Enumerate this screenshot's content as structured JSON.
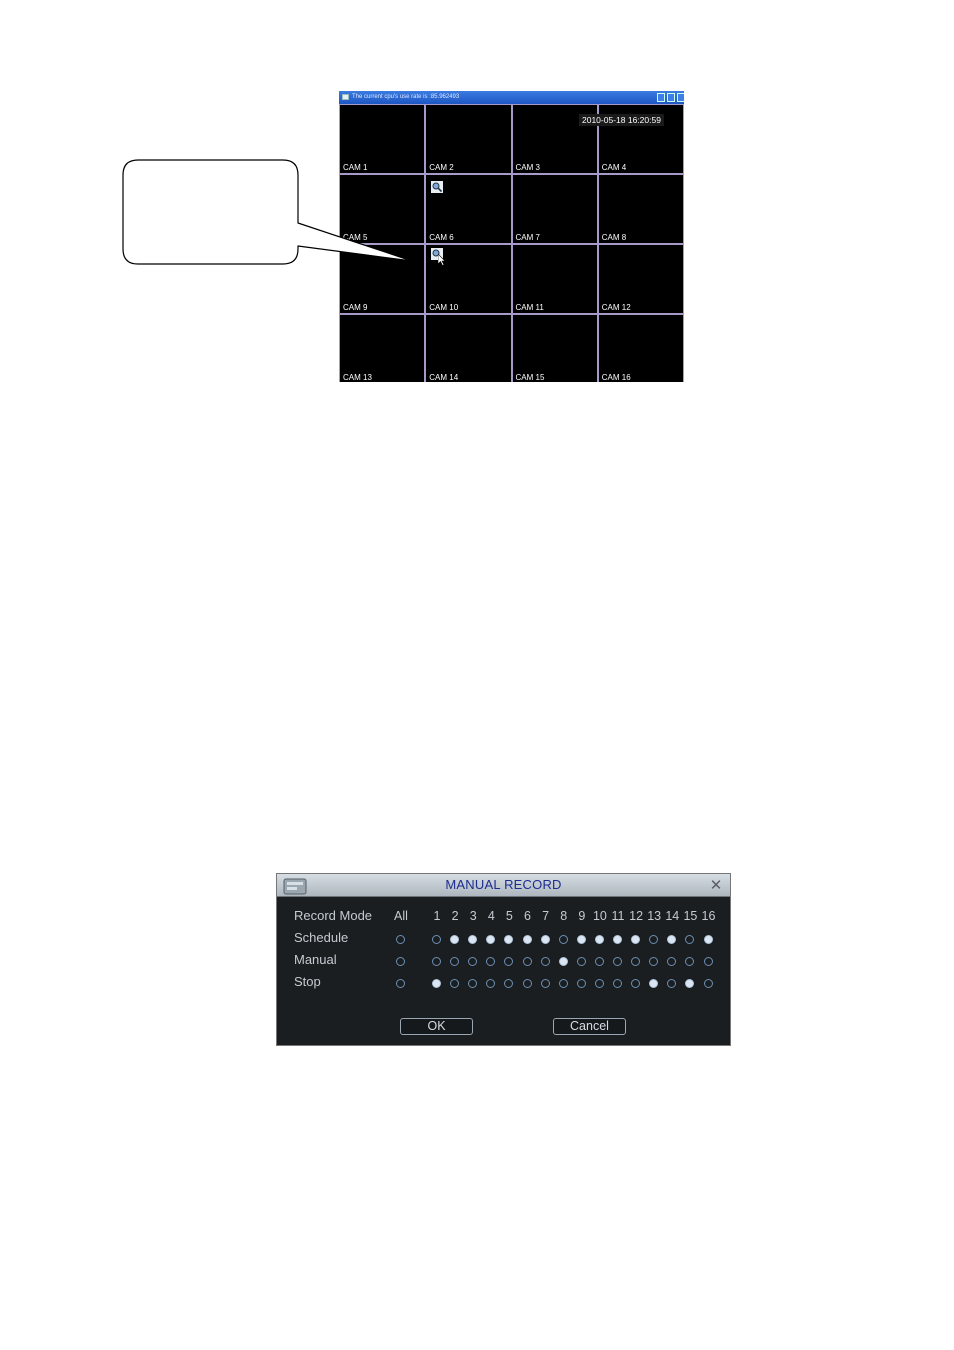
{
  "monitor": {
    "title": "The current cpu's use rate is :85.962493",
    "timestamp": "2010-05-18 16:20:59",
    "cameras": [
      "CAM 1",
      "CAM 2",
      "CAM 3",
      "CAM 4",
      "CAM 5",
      "CAM 6",
      "CAM 7",
      "CAM 8",
      "CAM 9",
      "CAM 10",
      "CAM 11",
      "CAM 12",
      "CAM 13",
      "CAM 14",
      "CAM 15",
      "CAM 16"
    ],
    "icons": [
      "zoom-icon",
      "cursor-icon"
    ]
  },
  "dialog": {
    "title": "MANUAL RECORD",
    "column_header": "Record Mode",
    "all_label": "All",
    "channels": [
      "1",
      "2",
      "3",
      "4",
      "5",
      "6",
      "7",
      "8",
      "9",
      "10",
      "11",
      "12",
      "13",
      "14",
      "15",
      "16"
    ],
    "rows": [
      {
        "label": "Schedule",
        "all": false,
        "selected": [
          2,
          3,
          4,
          5,
          6,
          7,
          9,
          10,
          11,
          12,
          14,
          16
        ]
      },
      {
        "label": "Manual",
        "all": false,
        "selected": [
          8
        ]
      },
      {
        "label": "Stop",
        "all": false,
        "selected": [
          1,
          13,
          15
        ]
      }
    ],
    "ok_label": "OK",
    "cancel_label": "Cancel",
    "colors": {
      "title": "#1c2c8f",
      "background": "#1b1e20",
      "radio_on": "#dbe6f2",
      "radio_border": "#6c8fb4"
    }
  }
}
